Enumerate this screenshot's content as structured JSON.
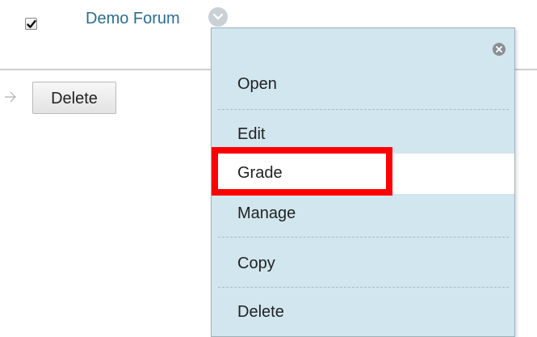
{
  "row": {
    "checkbox_checked": true,
    "forum_title": "Demo Forum"
  },
  "toolbar": {
    "delete_label": "Delete"
  },
  "context_menu": {
    "items": [
      {
        "label": "Open"
      },
      {
        "label": "Edit"
      },
      {
        "label": "Grade",
        "highlighted": true
      },
      {
        "label": "Manage"
      },
      {
        "label": "Copy"
      },
      {
        "label": "Delete"
      }
    ]
  },
  "colors": {
    "link": "#2a6e94",
    "menu_bg": "#d1e6ee",
    "highlight_box": "#ff0000"
  }
}
